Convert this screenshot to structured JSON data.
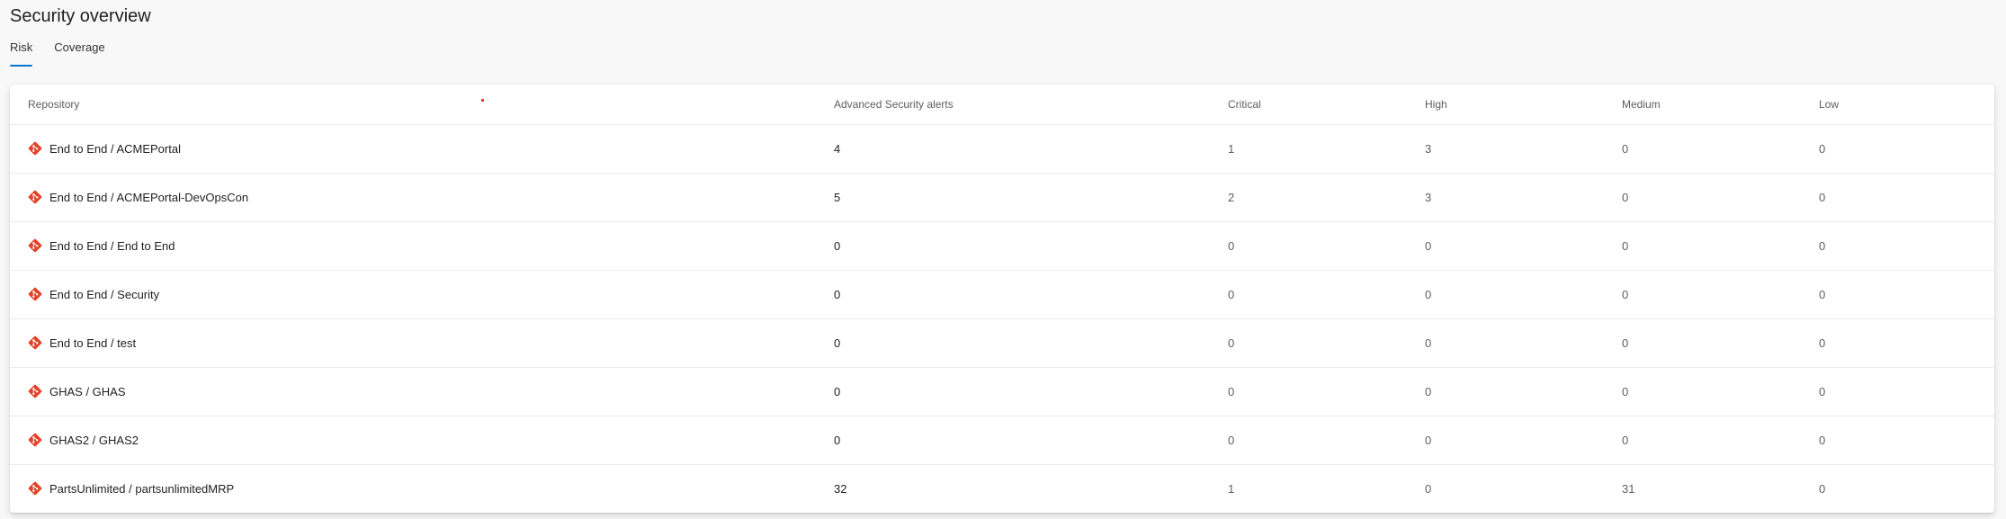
{
  "header": {
    "title": "Security overview"
  },
  "tabs": [
    {
      "label": "Risk",
      "selected": true
    },
    {
      "label": "Coverage",
      "selected": false
    }
  ],
  "table": {
    "columns": [
      "Repository",
      "Advanced Security alerts",
      "Critical",
      "High",
      "Medium",
      "Low"
    ],
    "rows": [
      {
        "repository": "End to End / ACMEPortal",
        "alerts": "4",
        "critical": "1",
        "high": "3",
        "medium": "0",
        "low": "0"
      },
      {
        "repository": "End to End / ACMEPortal-DevOpsCon",
        "alerts": "5",
        "critical": "2",
        "high": "3",
        "medium": "0",
        "low": "0"
      },
      {
        "repository": "End to End / End to End",
        "alerts": "0",
        "critical": "0",
        "high": "0",
        "medium": "0",
        "low": "0"
      },
      {
        "repository": "End to End / Security",
        "alerts": "0",
        "critical": "0",
        "high": "0",
        "medium": "0",
        "low": "0"
      },
      {
        "repository": "End to End / test",
        "alerts": "0",
        "critical": "0",
        "high": "0",
        "medium": "0",
        "low": "0"
      },
      {
        "repository": "GHAS / GHAS",
        "alerts": "0",
        "critical": "0",
        "high": "0",
        "medium": "0",
        "low": "0"
      },
      {
        "repository": "GHAS2 / GHAS2",
        "alerts": "0",
        "critical": "0",
        "high": "0",
        "medium": "0",
        "low": "0"
      },
      {
        "repository": "PartsUnlimited / partsunlimitedMRP",
        "alerts": "32",
        "critical": "1",
        "high": "0",
        "medium": "31",
        "low": "0"
      }
    ]
  },
  "icons": {
    "repo_icon": "git-repo-icon"
  },
  "colors": {
    "accent": "#0078d4",
    "git_icon": "#e24329",
    "indicator_dot": "#e81123"
  }
}
